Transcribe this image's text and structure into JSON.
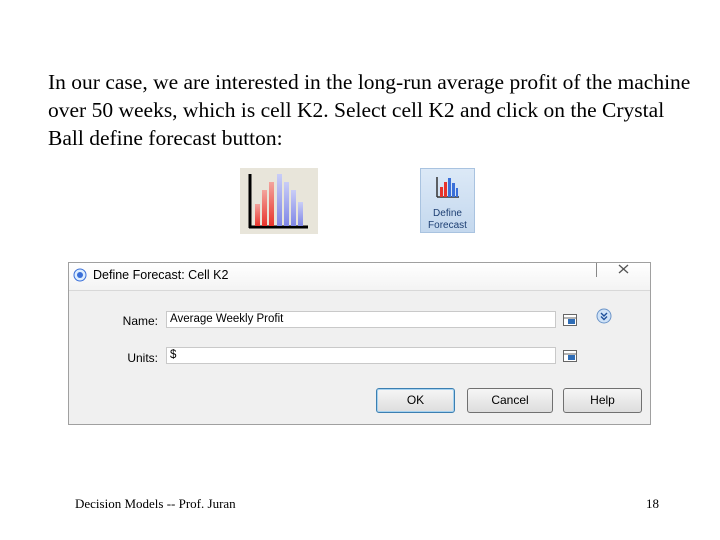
{
  "slide": {
    "body_text": "In our case, we are interested in the long-run average profit of the machine over 50 weeks, which is cell K2. Select cell K2 and click on the Crystal Ball define forecast button:",
    "footer_left": "Decision Models -- Prof. Juran",
    "page_number": "18"
  },
  "define_forecast_button": {
    "line1": "Define",
    "line2": "Forecast"
  },
  "dialog": {
    "title": "Define Forecast: Cell K2",
    "name_label": "Name:",
    "name_value": "Average Weekly Profit",
    "units_label": "Units:",
    "units_value": "$",
    "ok_label": "OK",
    "cancel_label": "Cancel",
    "help_label": "Help"
  },
  "colors": {
    "bar_red": "#e8332b",
    "bar_blue": "#7f86e6",
    "ribbon_blue": "#2f6db6"
  }
}
